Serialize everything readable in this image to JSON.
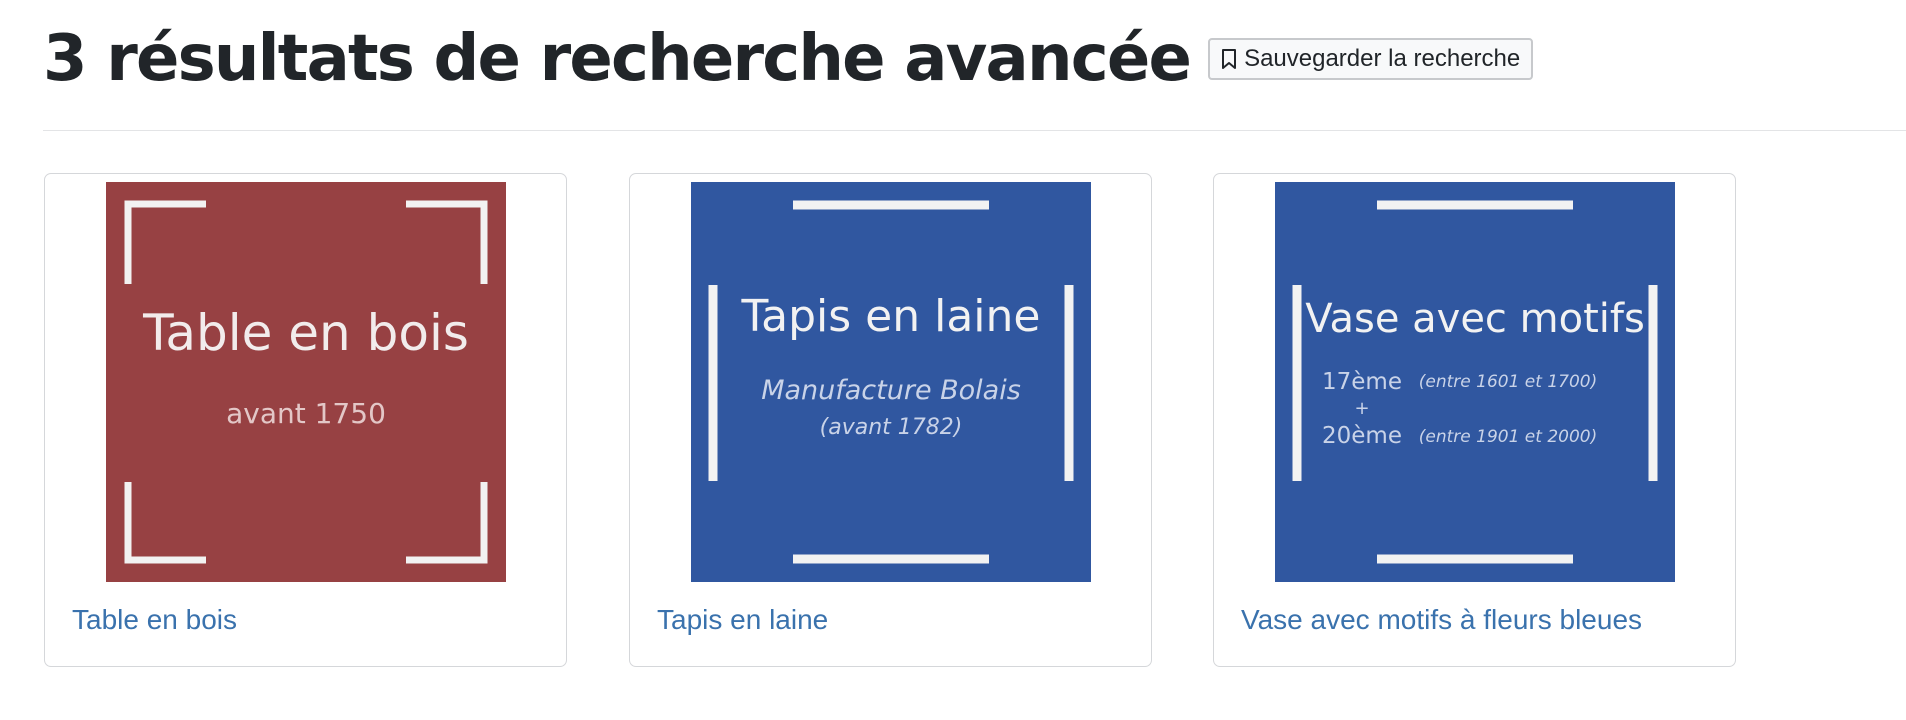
{
  "header": {
    "title": "3 résultats de recherche avancée",
    "save_button_label": "Sauvegarder la recherche",
    "save_button_icon": "bookmark-icon"
  },
  "colors": {
    "title": "#212529",
    "link": "#3a72ad",
    "thumb_red": "#974143",
    "thumb_blue": "#3057a0",
    "thumb_line": "#f2f2f2"
  },
  "results": [
    {
      "title": "Table en bois",
      "thumbnail": {
        "background": "#974143",
        "heading": "Table en bois",
        "subtitle": "avant 1750"
      }
    },
    {
      "title": "Tapis en laine",
      "thumbnail": {
        "background": "#3057a0",
        "heading": "Tapis en laine",
        "subtitle": "Manufacture Bolais",
        "note": "(avant 1782)"
      }
    },
    {
      "title": "Vase avec motifs à fleurs bleues",
      "thumbnail": {
        "background": "#3057a0",
        "heading": "Vase avec motifs",
        "period_1": "17ème",
        "period_1_range": "(entre 1601 et 1700)",
        "plus": "+",
        "period_2": "20ème",
        "period_2_range": "(entre 1901 et 2000)"
      }
    }
  ]
}
